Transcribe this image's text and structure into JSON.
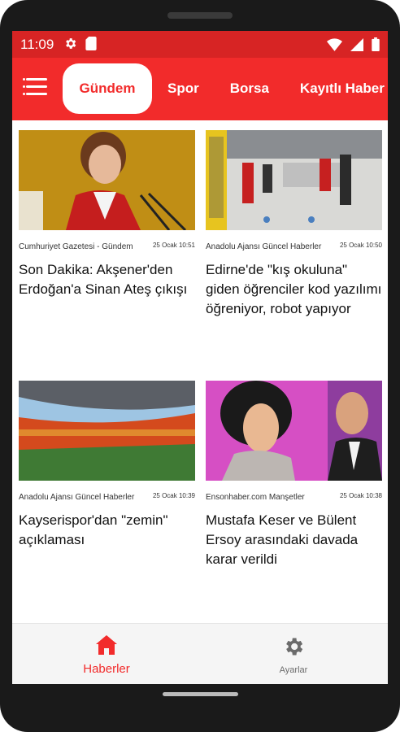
{
  "status": {
    "time": "11:09"
  },
  "tabs": [
    {
      "label": "Gündem",
      "active": true
    },
    {
      "label": "Spor"
    },
    {
      "label": "Borsa"
    },
    {
      "label": "Kayıtlı Haber"
    }
  ],
  "articles": [
    {
      "source": "Cumhuriyet Gazetesi - Gündem",
      "date": "25 Ocak 10:51",
      "title": "Son Dakika: Akşener'den Erdoğan'a Sinan Ateş çıkışı"
    },
    {
      "source": "Anadolu Ajansı Güncel Haberler",
      "date": "25 Ocak 10:50",
      "title": "Edirne'de \"kış okuluna\" giden öğrenciler kod yazılımı öğreniyor, robot yapıyor"
    },
    {
      "source": "Anadolu Ajansı Güncel Haberler",
      "date": "25 Ocak 10:39",
      "title": "Kayserispor'dan \"zemin\" açıklaması"
    },
    {
      "source": "Ensonhaber.com Manşetler",
      "date": "25 Ocak 10:38",
      "title": "Mustafa Keser ve Bülent Ersoy arasındaki davada karar verildi"
    }
  ],
  "bottom_nav": {
    "news_label": "Haberler",
    "settings_label": "Ayarlar"
  },
  "colors": {
    "accent": "#f22b2b",
    "statusbar": "#d72424"
  }
}
